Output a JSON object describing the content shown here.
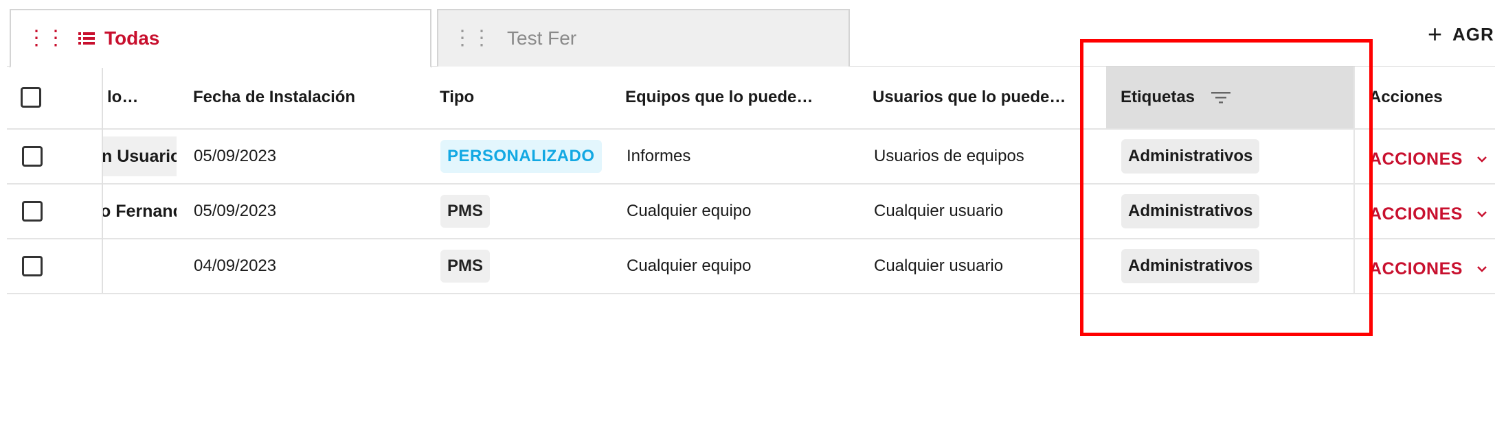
{
  "tabs": [
    {
      "label": "Todas",
      "active": true
    },
    {
      "label": "Test Fer",
      "active": false
    }
  ],
  "add_button": {
    "label": "AGR"
  },
  "table": {
    "headers": {
      "col1": "lo…",
      "fecha": "Fecha de Instalación",
      "tipo": "Tipo",
      "equipos": "Equipos que lo puede…",
      "usuarios": "Usuarios que lo puede…",
      "etiquetas": "Etiquetas",
      "acciones": "Acciones"
    },
    "rows": [
      {
        "col1": "n Usuario",
        "fecha": "05/09/2023",
        "tipo": "PERSONALIZADO",
        "equipos": "Informes",
        "usuarios": "Usuarios de equipos",
        "etiqueta": "Administrativos",
        "acciones": "ACCIONES"
      },
      {
        "col1": "o Fernand",
        "fecha": "05/09/2023",
        "tipo": "PMS",
        "equipos": "Cualquier equipo",
        "usuarios": "Cualquier usuario",
        "etiqueta": "Administrativos",
        "acciones": "ACCIONES"
      },
      {
        "col1": "",
        "fecha": "04/09/2023",
        "tipo": "PMS",
        "equipos": "Cualquier equipo",
        "usuarios": "Cualquier usuario",
        "etiqueta": "Administrativos",
        "acciones": "ACCIONES"
      }
    ]
  },
  "colors": {
    "accent": "#c8102e",
    "custom_badge": "#12a8e3",
    "highlight": "#ff0000"
  },
  "icons": [
    "drag-handle-icon",
    "list-icon",
    "plus-icon",
    "filter-icon",
    "chevron-down-icon"
  ]
}
